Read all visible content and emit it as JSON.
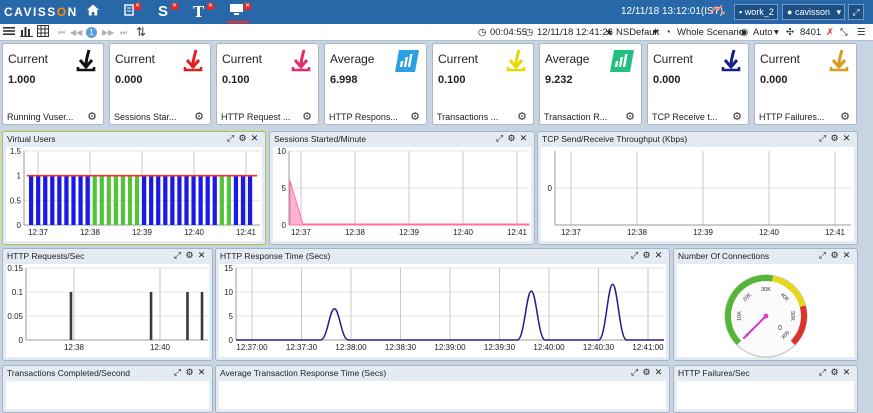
{
  "header": {
    "logo_prefix": "CAVISS",
    "logo_o": "O",
    "logo_suffix": "N",
    "datetime": "12/11/18 13:12:01(IST)",
    "work_label": "work_2",
    "user_label": "cavisson",
    "icons": [
      "home-icon",
      "script-icon",
      "session-icon",
      "text-icon",
      "monitor-icon",
      "alert-icon",
      "expand-icon"
    ]
  },
  "toolbar": {
    "page_number": "1",
    "elapsed": "00:04:55",
    "start_time": "12/11/18 12:41:26",
    "profile": "NSDefault",
    "scenario": "Whole Scenario",
    "mode": "Auto",
    "port": "8401"
  },
  "cards": [
    {
      "label": "Current",
      "value": "1.000",
      "footer": "Running Vuser...",
      "icon": "down-arrow-icon",
      "color": "#111111"
    },
    {
      "label": "Current",
      "value": "0.000",
      "footer": "Sessions Star...",
      "icon": "down-arrow-icon",
      "color": "#e02020"
    },
    {
      "label": "Current",
      "value": "0.100",
      "footer": "HTTP Request ...",
      "icon": "down-arrow-icon",
      "color": "#e02c6b"
    },
    {
      "label": "Average",
      "value": "6.998",
      "footer": "HTTP Respons...",
      "icon": "bar-chart-icon",
      "color": "#2aa0e0"
    },
    {
      "label": "Current",
      "value": "0.100",
      "footer": "Transactions ...",
      "icon": "down-arrow-icon",
      "color": "#e5d800"
    },
    {
      "label": "Average",
      "value": "9.232",
      "footer": "Transaction R...",
      "icon": "bar-chart-icon",
      "color": "#20c080"
    },
    {
      "label": "Current",
      "value": "0.000",
      "footer": "TCP Receive t...",
      "icon": "down-arrow-icon",
      "color": "#1a1e8a"
    },
    {
      "label": "Current",
      "value": "0.000",
      "footer": "HTTP Failures...",
      "icon": "down-arrow-icon",
      "color": "#d89c1c"
    }
  ],
  "panels": {
    "virtual_users": {
      "title": "Virtual Users"
    },
    "sessions": {
      "title": "Sessions Started/Minute"
    },
    "tcp": {
      "title": "TCP Send/Receive Throughput (Kbps)"
    },
    "http_req": {
      "title": "HTTP Requests/Sec"
    },
    "http_resp": {
      "title": "HTTP Response Time (Secs)"
    },
    "connections": {
      "title": "Number Of Connections"
    },
    "transactions": {
      "title": "Transactions Completed/Second"
    },
    "avg_txn": {
      "title": "Average Transaction Response Time (Secs)"
    },
    "http_fail": {
      "title": "HTTP Failures/Sec"
    }
  },
  "chart_data": [
    {
      "id": "virtual_users",
      "type": "bar",
      "title": "Virtual Users",
      "x_ticks": [
        "12:37",
        "12:38",
        "12:39",
        "12:40",
        "12:41"
      ],
      "y_ticks": [
        "0",
        "0.5",
        "1",
        "1.5"
      ],
      "ylim": [
        0,
        1.5
      ],
      "threshold": 1,
      "values": [
        1,
        1,
        1,
        1,
        1,
        1,
        1,
        1,
        1,
        1,
        1,
        1,
        1,
        1,
        1,
        1,
        1,
        1,
        1,
        1,
        1,
        1,
        1,
        1,
        1,
        1,
        1,
        1,
        1,
        1,
        1,
        1
      ],
      "colors": [
        "#1a1ae6",
        "#1a1ae6",
        "#1a1ae6",
        "#1a1ae6",
        "#1a1ae6",
        "#1a1ae6",
        "#1a1ae6",
        "#1a1ae6",
        "#1a1ae6",
        "#54c23a",
        "#54c23a",
        "#54c23a",
        "#54c23a",
        "#54c23a",
        "#54c23a",
        "#54c23a",
        "#1a1ae6",
        "#1a1ae6",
        "#1a1ae6",
        "#1a1ae6",
        "#1a1ae6",
        "#1a1ae6",
        "#1a1ae6",
        "#1a1ae6",
        "#1a1ae6",
        "#1a1ae6",
        "#1a1ae6",
        "#54c23a",
        "#54c23a",
        "#1a1ae6",
        "#1a1ae6",
        "#1a1ae6"
      ]
    },
    {
      "id": "sessions",
      "type": "area",
      "title": "Sessions Started/Minute",
      "x_ticks": [
        "12:37",
        "12:38",
        "12:39",
        "12:40",
        "12:41"
      ],
      "y_ticks": [
        "0",
        "5",
        "10"
      ],
      "ylim": [
        0,
        10
      ],
      "peak": 6,
      "color": "#ff6fa5"
    },
    {
      "id": "tcp",
      "type": "line",
      "title": "TCP Send/Receive Throughput (Kbps)",
      "x_ticks": [
        "12:37",
        "12:38",
        "12:39",
        "12:40",
        "12:41"
      ],
      "y_ticks": [
        "0"
      ]
    },
    {
      "id": "http_req",
      "type": "bar",
      "title": "HTTP Requests/Sec",
      "x_ticks": [
        "12:38",
        "12:40"
      ],
      "y_ticks": [
        "0",
        "0.05",
        "0.1",
        "0.15"
      ],
      "ylim": [
        0,
        0.15
      ],
      "spikes": [
        0.1,
        0.1,
        0.1,
        0.1
      ],
      "color": "#3a3a3a"
    },
    {
      "id": "http_resp",
      "type": "line",
      "title": "HTTP Response Time (Secs)",
      "x_ticks": [
        "12:37:00",
        "12:37:30",
        "12:38:00",
        "12:38:30",
        "12:39:00",
        "12:39:30",
        "12:40:00",
        "12:40:30",
        "12:41:00"
      ],
      "y_ticks": [
        "0",
        "5",
        "10",
        "15"
      ],
      "ylim": [
        0,
        15
      ],
      "peaks": [
        6.5,
        10.2,
        11.6
      ],
      "color": "#2a1a8a"
    },
    {
      "id": "connections",
      "type": "gauge",
      "title": "Number Of Connections",
      "gauge_ticks": [
        "0",
        "10K",
        "20K",
        "30K",
        "40K",
        "50K",
        "60K"
      ],
      "value": 0
    }
  ]
}
